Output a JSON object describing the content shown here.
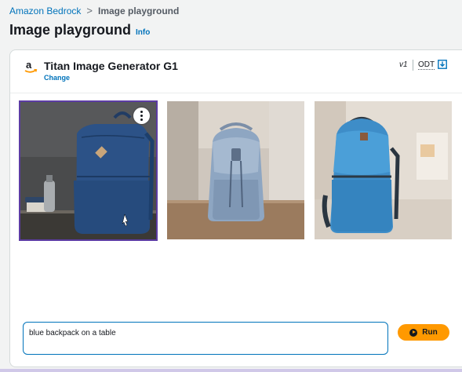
{
  "breadcrumb": {
    "root": "Amazon Bedrock",
    "separator": ">",
    "current": "Image playground"
  },
  "header": {
    "title": "Image playground",
    "info": "Info"
  },
  "model": {
    "logo_letter": "a",
    "name": "Titan Image Generator G1",
    "change": "Change",
    "version": "v1",
    "odt": "ODT",
    "download_icon": "download-icon"
  },
  "images": [
    {
      "name": "generated-image-1",
      "selected": true,
      "description_icon": "backpack"
    },
    {
      "name": "generated-image-2",
      "selected": false,
      "description_icon": "backpack"
    },
    {
      "name": "generated-image-3",
      "selected": false,
      "description_icon": "backpack"
    }
  ],
  "prompt": {
    "value": "blue backpack on a table"
  },
  "run": {
    "label": "Run",
    "icon": "play-icon"
  },
  "colors": {
    "accent": "#0073bb",
    "run": "#ff9900",
    "selection": "#5c3ca3"
  }
}
